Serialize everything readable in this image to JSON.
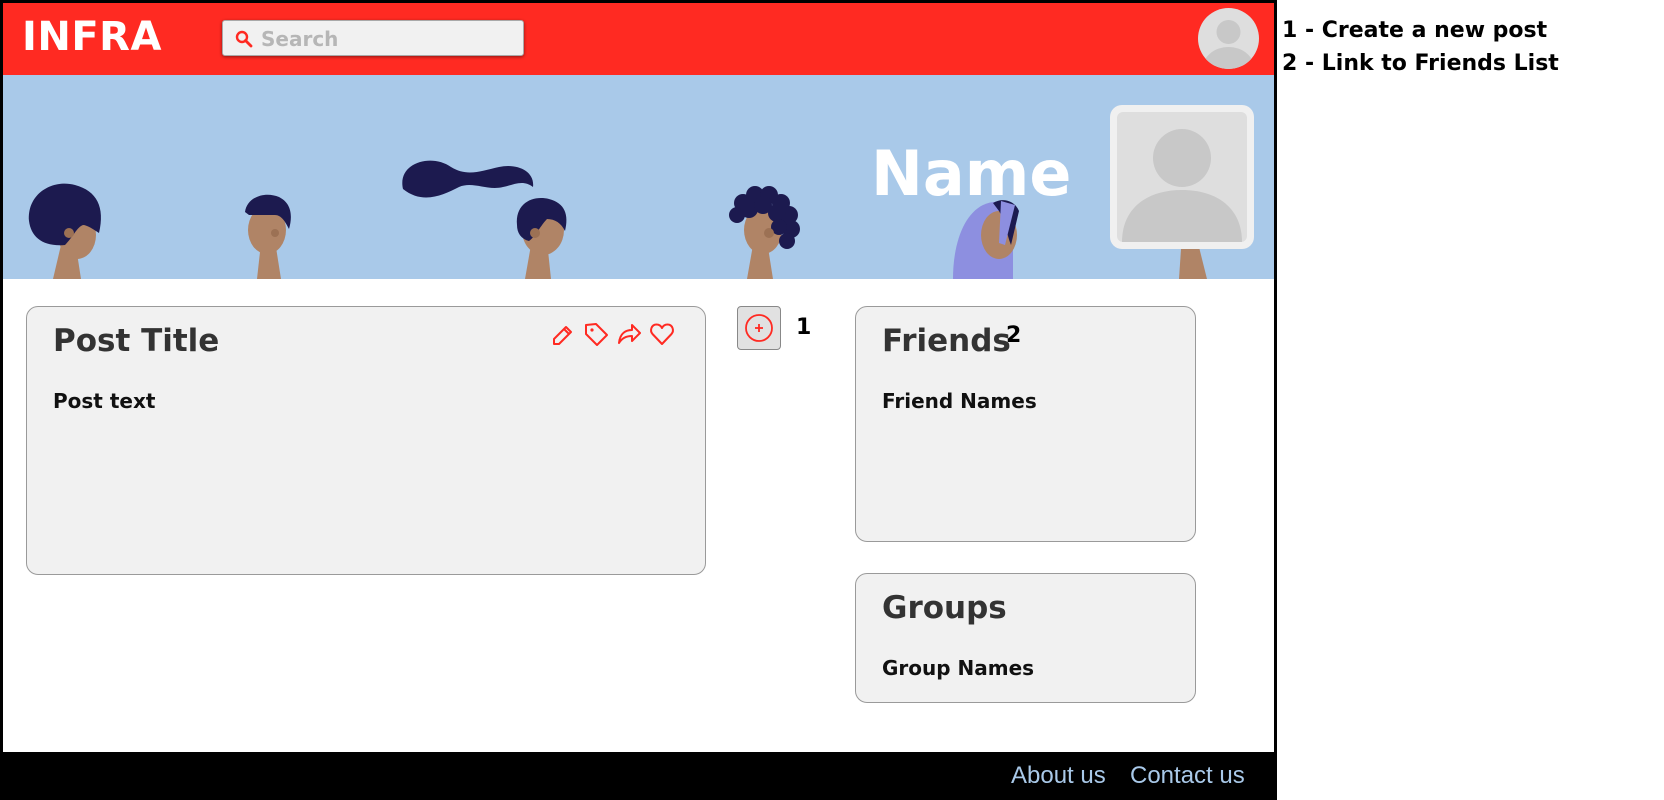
{
  "header": {
    "brand": "INFRA",
    "search_placeholder": "Search"
  },
  "profile": {
    "name": "Name"
  },
  "post": {
    "title": "Post Title",
    "text": "Post text",
    "actions": [
      "edit-icon",
      "tag-icon",
      "share-icon",
      "heart-icon"
    ]
  },
  "new_post": {
    "icon": "plus-circle-icon",
    "marker": "1"
  },
  "friends": {
    "title": "Friends",
    "marker": "2",
    "names": "Friend Names"
  },
  "groups": {
    "title": "Groups",
    "names": "Group Names"
  },
  "footer": {
    "about": "About us",
    "contact": "Contact us"
  },
  "legend": [
    "1 - Create a new post",
    "2 - Link to Friends List"
  ],
  "colors": {
    "header_red": "#ff2a22",
    "banner_blue": "#a9c9e9",
    "card_bg": "#f1f1f1",
    "footer_black": "#000000",
    "hair_navy": "#1c1a4f",
    "skin": "#b08466"
  }
}
